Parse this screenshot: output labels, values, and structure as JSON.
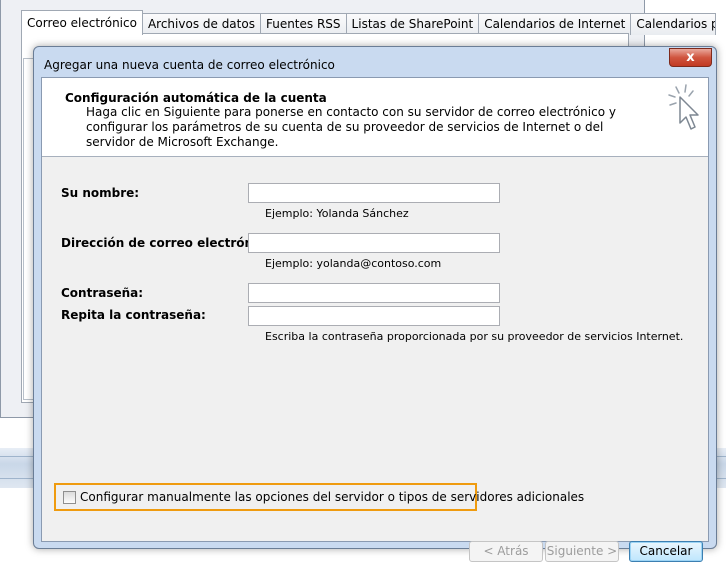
{
  "background_window": {
    "tabs": [
      "Correo electrónico",
      "Archivos de datos",
      "Fuentes RSS",
      "Listas de SharePoint",
      "Calendarios de Internet",
      "Calendarios p"
    ]
  },
  "dialog": {
    "title": "Agregar una nueva cuenta de correo electrónico",
    "close_glyph": "x",
    "banner": {
      "heading": "Configuración automática de la cuenta",
      "description": "Haga clic en Siguiente para ponerse en contacto con su servidor de correo electrónico y configurar los parámetros de su cuenta de su proveedor de servicios de Internet o del servidor de Microsoft Exchange."
    },
    "form": {
      "name_label": "Su nombre:",
      "name_value": "",
      "name_hint": "Ejemplo: Yolanda Sánchez",
      "email_label": "Dirección de correo electrónico:",
      "email_value": "",
      "email_hint": "Ejemplo: yolanda@contoso.com",
      "password_label": "Contraseña:",
      "password_value": "",
      "repeat_label": "Repita la contraseña:",
      "repeat_value": "",
      "password_hint": "Escriba la contraseña proporcionada por su proveedor de servicios Internet."
    },
    "manual_config": {
      "label": "Configurar manualmente las opciones del servidor o tipos de servidores adicionales",
      "checked": false,
      "highlight_color": "#ef9b0f"
    },
    "buttons": {
      "back": "< Atrás",
      "next": "Siguiente >",
      "cancel": "Cancelar"
    }
  }
}
